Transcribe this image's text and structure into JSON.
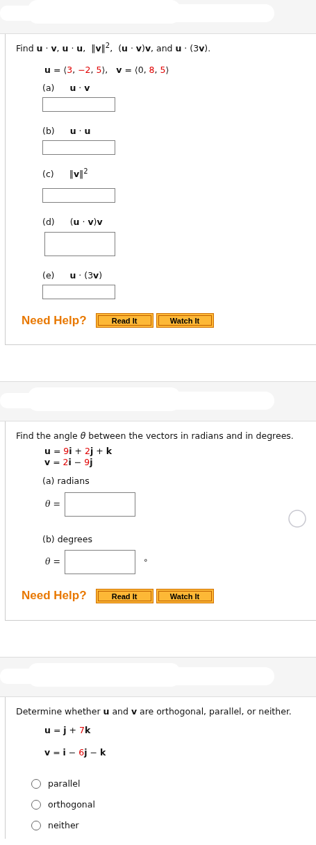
{
  "problems": [
    {
      "kind": "parts",
      "prompt": "Find **u** · **v**, **u** · **u**,  ‖**v**‖$^{2}$,  (**u** · **v**)**v**, and **u** · (3**v**).",
      "given": [
        [
          {
            "kind": "term",
            "text": "**u** = ⟨"
          },
          {
            "kind": "coefficient",
            "text": "3"
          },
          {
            "kind": "term",
            "text": ", "
          },
          {
            "kind": "coefficient",
            "text": "−2"
          },
          {
            "kind": "term",
            "text": ", "
          },
          {
            "kind": "coefficient",
            "text": "5"
          },
          {
            "kind": "term",
            "text": "⟩,   **v** = ⟨0, "
          },
          {
            "kind": "coefficient",
            "text": "8"
          },
          {
            "kind": "term",
            "text": ", "
          },
          {
            "kind": "coefficient",
            "text": "5"
          },
          {
            "kind": "term",
            "text": "⟩"
          }
        ]
      ],
      "parts": [
        {
          "label": "(a)",
          "expr": "**u** · **v**",
          "kind": "scalar"
        },
        {
          "label": "(b)",
          "expr": "**u** · **u**",
          "kind": "scalar"
        },
        {
          "label": "(c)",
          "expr": "‖**v**‖$^{2}$",
          "kind": "scalar"
        },
        {
          "label": "(d)",
          "expr": "(**u** · **v**)**v**",
          "kind": "vector"
        },
        {
          "label": "(e)",
          "expr": "**u** · (3**v**)",
          "kind": "scalar"
        }
      ],
      "help": {
        "label": "Need Help?",
        "buttons": [
          "Read It",
          "Watch It"
        ]
      }
    },
    {
      "kind": "angle",
      "prompt": "Find the angle *θ* between the vectors in radians and in degrees.",
      "given": [
        [
          {
            "kind": "term",
            "text": "**u** = "
          },
          {
            "kind": "coefficient",
            "text": "9"
          },
          {
            "kind": "term",
            "text": "**i** + "
          },
          {
            "kind": "coefficient",
            "text": "2"
          },
          {
            "kind": "term",
            "text": "**j** + **k**"
          }
        ],
        [
          {
            "kind": "term",
            "text": "**v** = "
          },
          {
            "kind": "coefficient",
            "text": "2"
          },
          {
            "kind": "term",
            "text": "**i** − "
          },
          {
            "kind": "coefficient",
            "text": "9"
          },
          {
            "kind": "term",
            "text": "**j**"
          }
        ]
      ],
      "parts": [
        {
          "label": "(a) radians",
          "lhs": "θ ="
        },
        {
          "label": "(b) degrees",
          "lhs": "θ =",
          "unit": "°"
        }
      ],
      "help": {
        "label": "Need Help?",
        "buttons": [
          "Read It",
          "Watch It"
        ]
      }
    },
    {
      "kind": "choice",
      "prompt": "Determine whether **u** and **v** are orthogonal, parallel, or neither.",
      "given": [
        [
          {
            "kind": "term",
            "text": "**u** = **j** + "
          },
          {
            "kind": "coefficient",
            "text": "7"
          },
          {
            "kind": "term",
            "text": "**k**"
          }
        ],
        [
          {
            "kind": "term",
            "text": "**v** = **i** − "
          },
          {
            "kind": "coefficient",
            "text": "6"
          },
          {
            "kind": "term",
            "text": "**j** − **k**"
          }
        ]
      ],
      "options": [
        {
          "label": "parallel",
          "selected": false
        },
        {
          "label": "orthogonal",
          "selected": false
        },
        {
          "label": "neither",
          "selected": false
        }
      ]
    }
  ]
}
